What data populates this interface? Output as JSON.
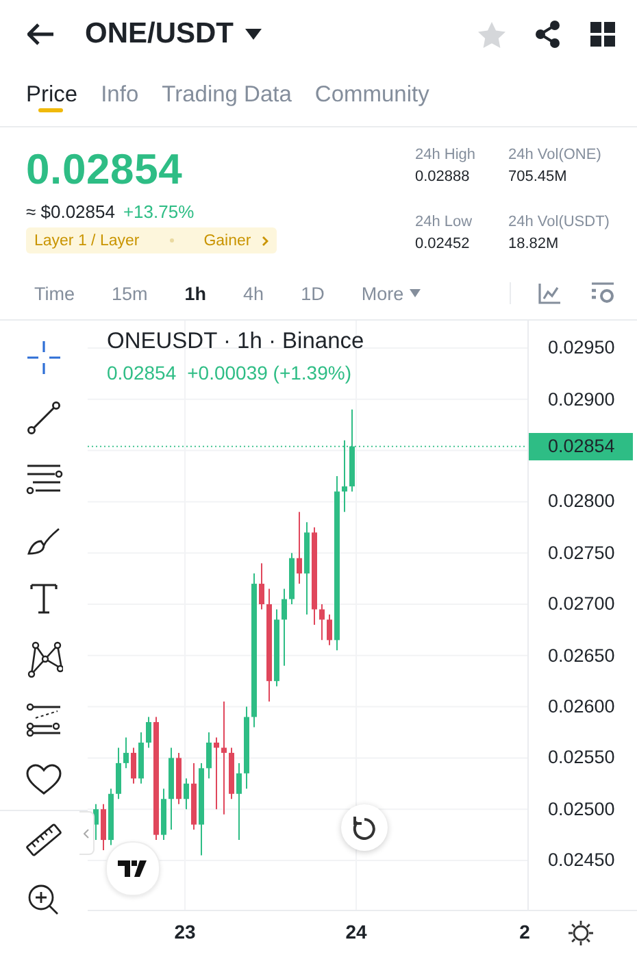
{
  "header": {
    "title": "ONE/USDT",
    "favorite": false
  },
  "tabs": [
    {
      "label": "Price",
      "selected": true
    },
    {
      "label": "Info",
      "selected": false
    },
    {
      "label": "Trading Data",
      "selected": false
    },
    {
      "label": "Community",
      "selected": false
    }
  ],
  "ticker": {
    "price": "0.02854",
    "usd_price": "≈ $0.02854",
    "change": "+13.75%",
    "tags": [
      "Layer 1 / Layer",
      "Gainer"
    ],
    "stats": [
      {
        "label": "24h High",
        "value": "0.02888"
      },
      {
        "label": "24h Vol(ONE)",
        "value": "705.45M"
      },
      {
        "label": "24h Low",
        "value": "0.02452"
      },
      {
        "label": "24h Vol(USDT)",
        "value": "18.82M"
      }
    ]
  },
  "intervals": [
    {
      "label": "Time",
      "selected": false
    },
    {
      "label": "15m",
      "selected": false
    },
    {
      "label": "1h",
      "selected": true
    },
    {
      "label": "4h",
      "selected": false
    },
    {
      "label": "1D",
      "selected": false
    },
    {
      "label": "More",
      "selected": false
    }
  ],
  "chart": {
    "title": "ONEUSDT · 1h · Binance",
    "last": "0.02854",
    "change": "+0.00039 (+1.39%)",
    "price_ticks": [
      "0.02950",
      "0.02900",
      "0.02800",
      "0.02750",
      "0.02700",
      "0.02650",
      "0.02600",
      "0.02550",
      "0.02500",
      "0.02450"
    ],
    "current_price": "0.02854",
    "dates": [
      "23",
      "24",
      "2"
    ]
  }
}
